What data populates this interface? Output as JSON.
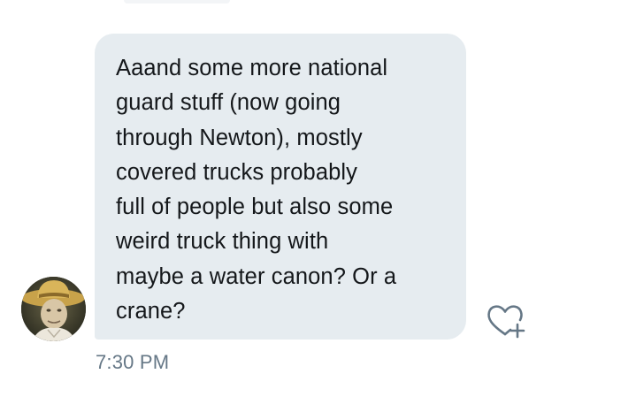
{
  "conversation": {
    "message": {
      "text": "Aaand some more national\nguard stuff (now going\nthrough Newton), mostly\ncovered trucks probably\nfull of people but also some\nweird truck thing with\nmaybe a water canon? Or a\ncrane?",
      "timestamp": "7:30 PM"
    },
    "avatar_icon": "user-avatar-photo",
    "like_icon": "heart-plus-icon"
  },
  "colors": {
    "bubble_background": "#e6ecf0",
    "text": "#14171a",
    "timestamp": "#657786",
    "icon": "#657786",
    "page_background": "#ffffff"
  }
}
